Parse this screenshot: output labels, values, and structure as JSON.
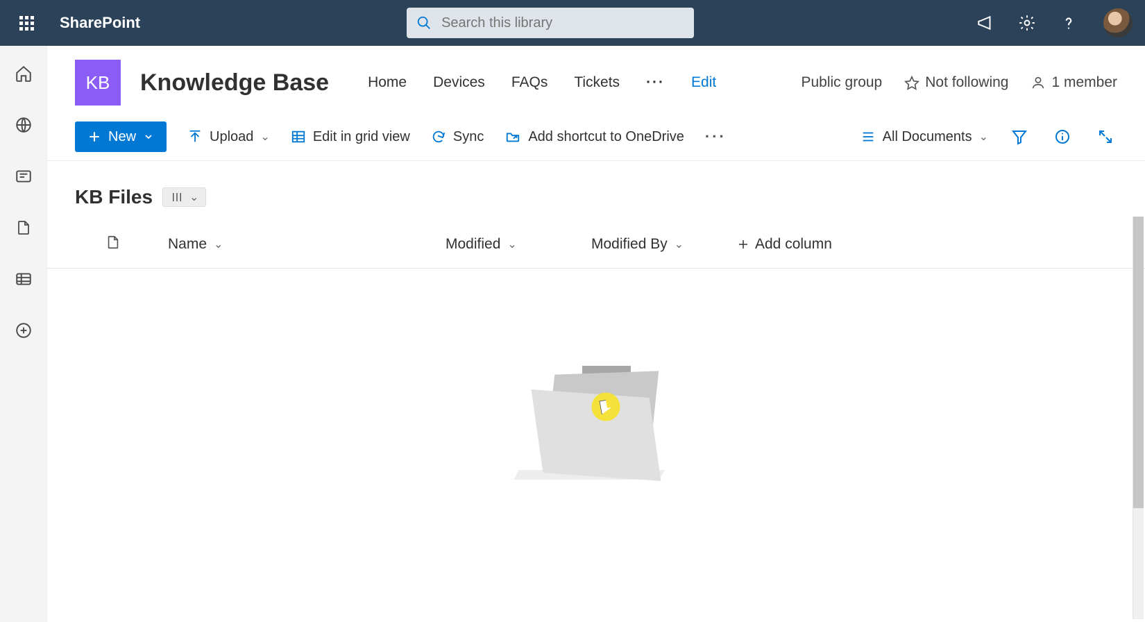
{
  "suite": {
    "brand": "SharePoint",
    "search_placeholder": "Search this library"
  },
  "site": {
    "logo_initials": "KB",
    "title": "Knowledge Base",
    "nav": {
      "home": "Home",
      "devices": "Devices",
      "faqs": "FAQs",
      "tickets": "Tickets",
      "more": "···",
      "edit": "Edit"
    },
    "meta": {
      "group": "Public group",
      "follow": "Not following",
      "members": "1 member"
    }
  },
  "commands": {
    "new": "New",
    "upload": "Upload",
    "grid": "Edit in grid view",
    "sync": "Sync",
    "shortcut": "Add shortcut to OneDrive",
    "more": "···",
    "view": "All Documents"
  },
  "library": {
    "title": "KB Files"
  },
  "columns": {
    "name": "Name",
    "modified": "Modified",
    "modified_by": "Modified By",
    "add": "Add column"
  }
}
